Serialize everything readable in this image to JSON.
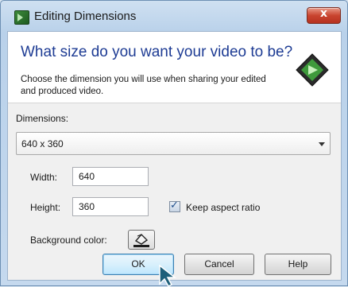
{
  "window": {
    "title": "Editing Dimensions",
    "close_glyph": "x"
  },
  "header": {
    "heading": "What size do you want your video to be?",
    "description": "Choose the dimension you will use when sharing your edited and produced video."
  },
  "dimensions": {
    "label": "Dimensions:",
    "selected": "640 x 360"
  },
  "width": {
    "label": "Width:",
    "value": "640"
  },
  "height": {
    "label": "Height:",
    "value": "360"
  },
  "aspect": {
    "label": "Keep aspect ratio",
    "checked": true,
    "check_glyph": "✓"
  },
  "background": {
    "label": "Background color:",
    "icon": "paint-bucket-icon"
  },
  "buttons": {
    "ok": "OK",
    "cancel": "Cancel",
    "help": "Help"
  },
  "colors": {
    "heading": "#1e3c94",
    "close": "#c9442f",
    "cursor": "#1e5f7a"
  }
}
